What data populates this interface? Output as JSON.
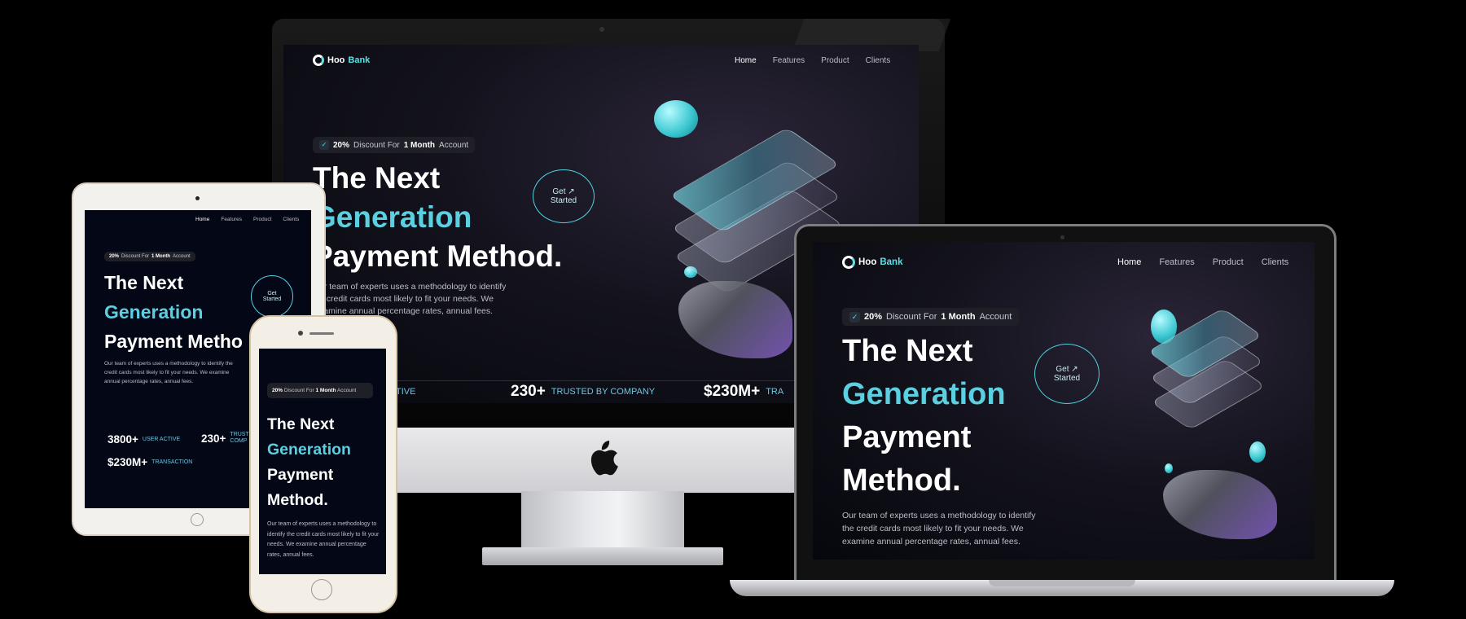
{
  "brand": {
    "name_a": "Hoo",
    "name_b": "Bank",
    "accent": "#5ce1e6"
  },
  "nav": [
    "Home",
    "Features",
    "Product",
    "Clients"
  ],
  "hero": {
    "badge_pct": "20%",
    "badge_mid": "Discount For",
    "badge_month": "1 Month",
    "badge_end": "Account",
    "line1": "The Next",
    "line2": "Generation",
    "line3": "Payment Method.",
    "line3a": "Payment",
    "line3b": "Method.",
    "ipad_line3": "Payment Metho",
    "imac_para_1": "ur team of experts uses a methodology to identify",
    "imac_para_2": "e credit cards most likely to fit your needs. We",
    "imac_para_3": "xamine annual percentage rates, annual fees.",
    "para": "Our team of experts uses a methodology to identify the credit cards most likely to fit your needs. We examine annual percentage rates, annual fees.",
    "cta_1": "Get ↗",
    "cta_2": "Started",
    "cta_2_ipad": "Started",
    "cta_1_ipad": "Get"
  },
  "stats": {
    "users_num": "3800+",
    "users_lbl": "USER ACTIVE",
    "users_lbl_cut": "ER ACTIVE",
    "trust_num": "230+",
    "trust_lbl": "TRUSTED BY COMPANY",
    "trust_lbl_a": "TRUST",
    "trust_lbl_b": "COMP",
    "tx_num": "$230M+",
    "tx_lbl": "TRANSACTION",
    "tx_lbl_cut": "TRA"
  },
  "apple_logo": "apple-icon"
}
